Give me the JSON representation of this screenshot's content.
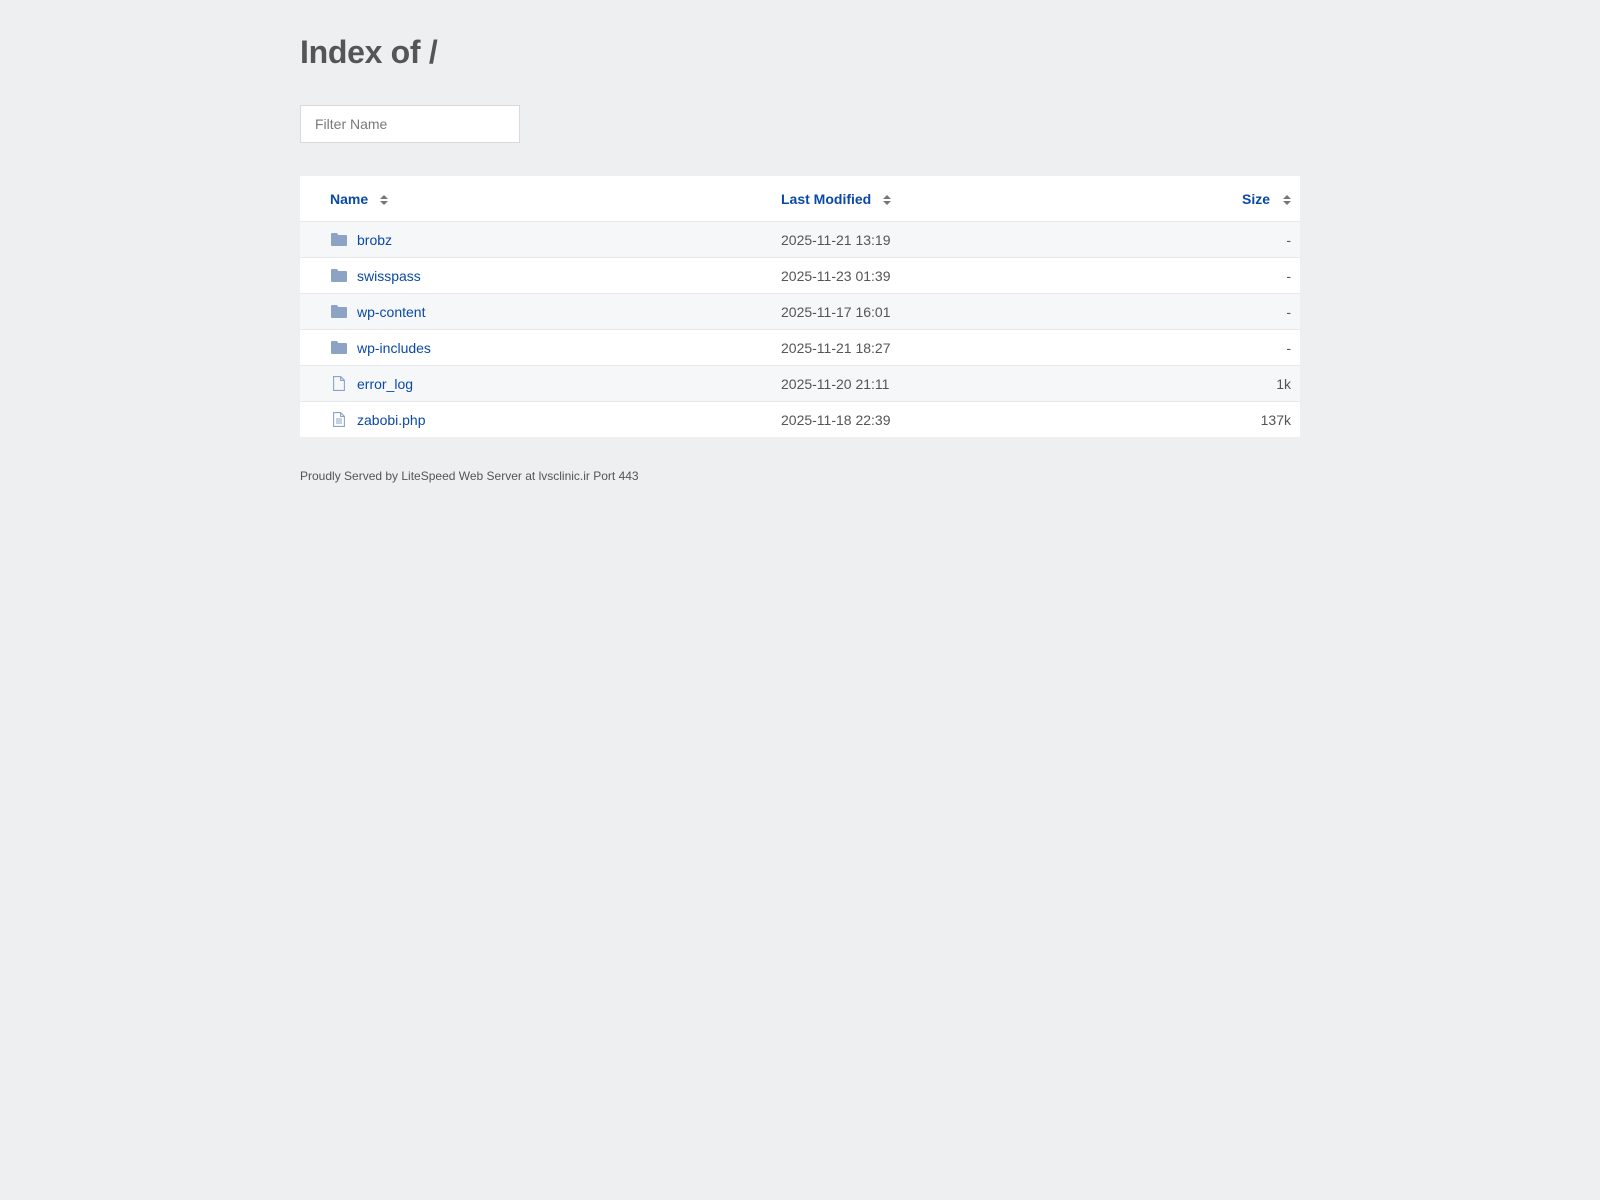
{
  "page": {
    "title": "Index of /",
    "filter_placeholder": "Filter Name",
    "footer": "Proudly Served by LiteSpeed Web Server at lvsclinic.ir Port 443"
  },
  "table": {
    "headers": {
      "name": "Name",
      "modified": "Last Modified",
      "size": "Size"
    },
    "rows": [
      {
        "name": "brobz",
        "modified": "2025-11-21 13:19",
        "size": "-",
        "icon": "folder-icon"
      },
      {
        "name": "swisspass",
        "modified": "2025-11-23 01:39",
        "size": "-",
        "icon": "folder-icon"
      },
      {
        "name": "wp-content",
        "modified": "2025-11-17 16:01",
        "size": "-",
        "icon": "folder-icon"
      },
      {
        "name": "wp-includes",
        "modified": "2025-11-21 18:27",
        "size": "-",
        "icon": "folder-icon"
      },
      {
        "name": "error_log",
        "modified": "2025-11-20 21:11",
        "size": "1k",
        "icon": "file-icon"
      },
      {
        "name": "zabobi.php",
        "modified": "2025-11-18 22:39",
        "size": "137k",
        "icon": "text-file-icon"
      }
    ]
  },
  "colors": {
    "background": "#eeeff1",
    "link": "#0b49a6",
    "folder_icon": "#8da3c6",
    "text": "#555555"
  }
}
